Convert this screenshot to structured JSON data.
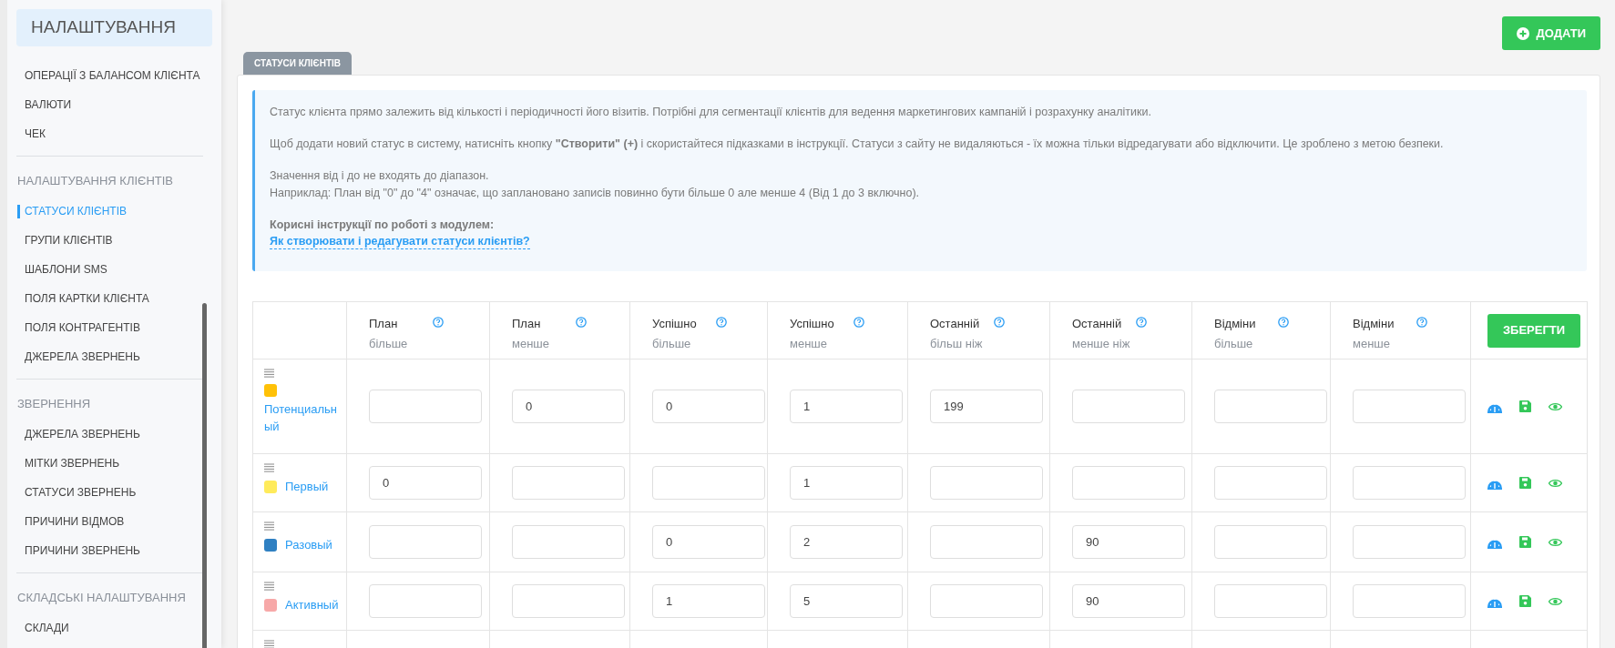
{
  "sidebar": {
    "title": "НАЛАШТУВАННЯ",
    "groups": [
      {
        "items": [
          {
            "label": "ОПЕРАЦІЇ З БАЛАНСОМ КЛІЄНТА",
            "selected": false
          },
          {
            "label": "ВАЛЮТИ",
            "selected": false
          },
          {
            "label": "ЧЕК",
            "selected": false
          }
        ]
      },
      {
        "heading": "НАЛАШТУВАННЯ КЛІЄНТІВ",
        "items": [
          {
            "label": "СТАТУСИ КЛІЄНТІВ",
            "selected": true
          },
          {
            "label": "ГРУПИ КЛІЄНТІВ",
            "selected": false
          },
          {
            "label": "ШАБЛОНИ SMS",
            "selected": false
          },
          {
            "label": "ПОЛЯ КАРТКИ КЛІЄНТА",
            "selected": false
          },
          {
            "label": "ПОЛЯ КОНТРАГЕНТІВ",
            "selected": false
          },
          {
            "label": "ДЖЕРЕЛА ЗВЕРНЕНЬ",
            "selected": false
          }
        ]
      },
      {
        "heading": "ЗВЕРНЕННЯ",
        "items": [
          {
            "label": "ДЖЕРЕЛА ЗВЕРНЕНЬ",
            "selected": false
          },
          {
            "label": "МІТКИ ЗВЕРНЕНЬ",
            "selected": false
          },
          {
            "label": "СТАТУСИ ЗВЕРНЕНЬ",
            "selected": false
          },
          {
            "label": "ПРИЧИНИ ВІДМОВ",
            "selected": false
          },
          {
            "label": "ПРИЧИНИ ЗВЕРНЕНЬ",
            "selected": false
          }
        ]
      },
      {
        "heading": "СКЛАДСЬКІ НАЛАШТУВАННЯ",
        "items": [
          {
            "label": "СКЛАДИ",
            "selected": false
          }
        ]
      }
    ]
  },
  "add_button": "ДОДАТИ",
  "tab": "СТАТУСИ КЛІЄНТІВ",
  "info": {
    "paragraphs": [
      "Статус клієнта прямо залежить від кількості і періодичності його візитів. Потрібні для сегментації клієнтів для ведення маркетингових кампаній і розрахунку аналітики.",
      "Щоб додати новий статус в систему, натисніть кнопку **\"Створити\"** **(+)** і скористайтеся підказками в інструкції. Статуси з сайту не видаляються - їх можна тільки відредагувати або відключити. Це зроблено з метою безпеки."
    ],
    "note_lines": [
      "Значення від і до не входять до діапазон.",
      "Наприклад: План від \"0\" до \"4\" означає, що заплановано записів повинно бути більше 0 але менше 4 (Від 1 до 3 включно)."
    ],
    "instructions_heading": "Корисні інструкції по роботі з модулем:",
    "link": "Як створювати і редагувати статуси клієнтів?"
  },
  "table": {
    "columns": [
      {
        "title": "План",
        "subtitle": "більше"
      },
      {
        "title": "План",
        "subtitle": "менше"
      },
      {
        "title": "Успішно",
        "subtitle": "більше"
      },
      {
        "title": "Успішно",
        "subtitle": "менше"
      },
      {
        "title": "Останній",
        "subtitle": "більш ніж"
      },
      {
        "title": "Останній",
        "subtitle": "менше ніж"
      },
      {
        "title": "Відміни",
        "subtitle": "більше"
      },
      {
        "title": "Відміни",
        "subtitle": "менше"
      }
    ],
    "save_button": "ЗБЕРЕГТИ",
    "rows": [
      {
        "name": "Потенциальный",
        "color": "#ffc107",
        "values": {
          "column_2": "0",
          "column_3": "0",
          "column_4": "1",
          "column_5": "199"
        }
      },
      {
        "name": "Первый",
        "color": "#ffeb5b",
        "values": {
          "column_1": "0",
          "column_4": "1"
        }
      },
      {
        "name": "Разовый",
        "color": "#2f80c2",
        "values": {
          "column_3": "0",
          "column_4": "2",
          "column_6": "90"
        }
      },
      {
        "name": "Активный",
        "color": "#f7a8a8",
        "values": {
          "column_3": "1",
          "column_4": "5",
          "column_6": "90"
        }
      },
      {
        "kind": "partial"
      }
    ]
  }
}
